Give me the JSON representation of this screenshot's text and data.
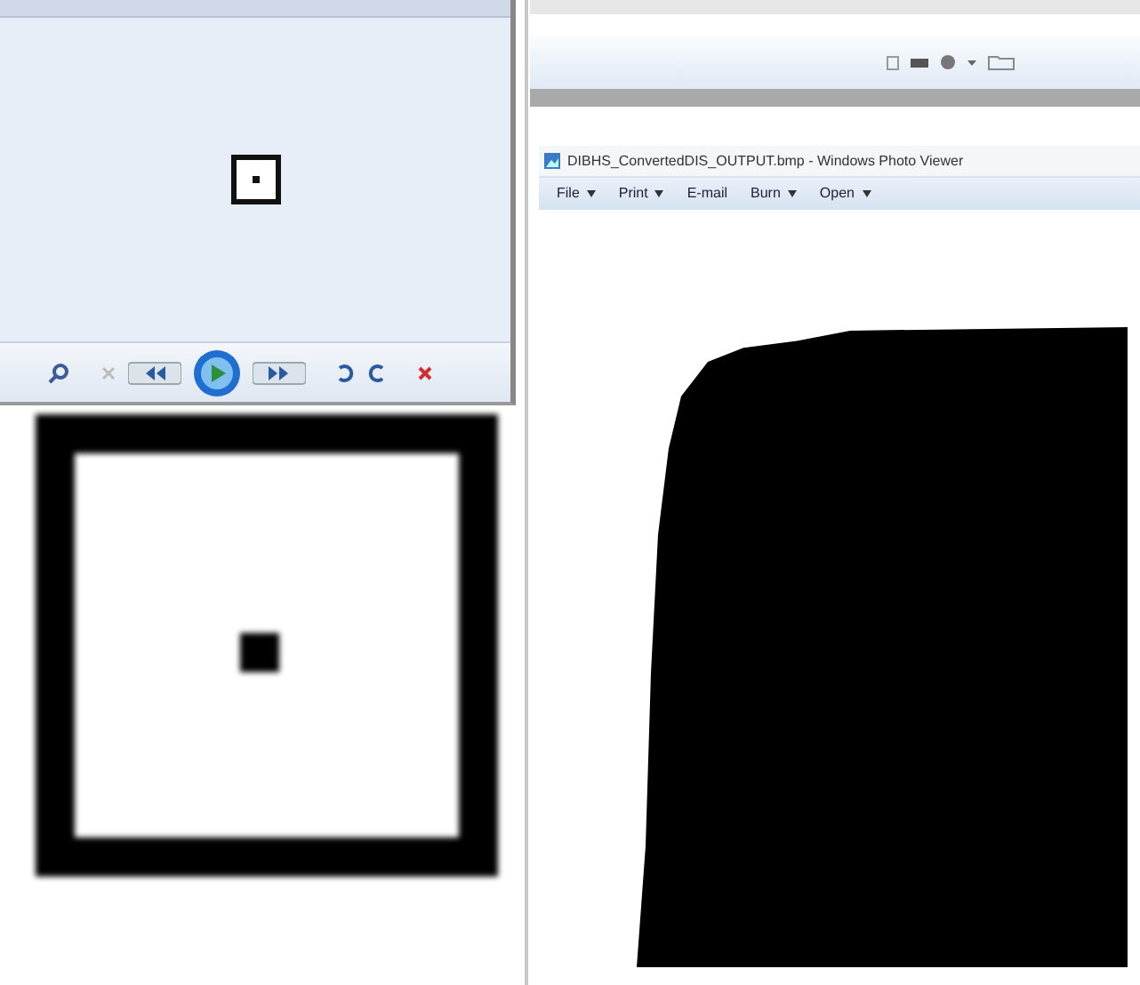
{
  "left_viewer": {
    "toolbar": [
      {
        "kind": "zoom"
      },
      {
        "kind": "fit"
      },
      {
        "kind": "previous"
      },
      {
        "kind": "play"
      },
      {
        "kind": "next"
      },
      {
        "kind": "rotate-left"
      },
      {
        "kind": "rotate-right"
      },
      {
        "kind": "delete"
      }
    ]
  },
  "photo_viewer": {
    "title": "DIBHS_ConvertedDIS_OUTPUT.bmp - Windows Photo Viewer",
    "menu": [
      {
        "label": "File",
        "has_dropdown": true
      },
      {
        "label": "Print",
        "has_dropdown": true
      },
      {
        "label": "E-mail",
        "has_dropdown": false
      },
      {
        "label": "Burn",
        "has_dropdown": true
      },
      {
        "label": "Open",
        "has_dropdown": true
      }
    ]
  }
}
